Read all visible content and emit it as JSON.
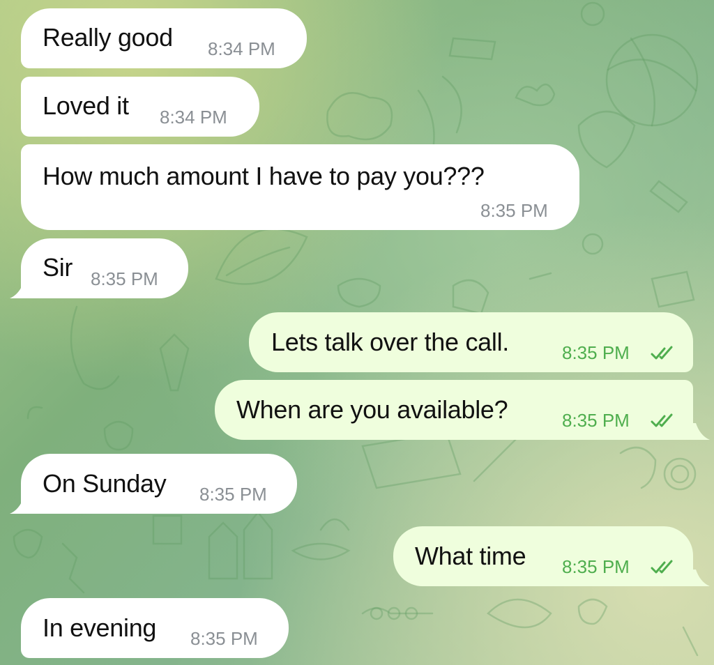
{
  "colors": {
    "incoming_bubble": "#ffffff",
    "outgoing_bubble": "#effedd",
    "incoming_time": "#8a8f94",
    "outgoing_time": "#4fae4e",
    "read_ticks": "#4fae4e"
  },
  "messages": [
    {
      "direction": "incoming",
      "text": "Really good",
      "time": "8:34 PM"
    },
    {
      "direction": "incoming",
      "text": "Loved it",
      "time": "8:34 PM"
    },
    {
      "direction": "incoming",
      "text": "How much amount I have to pay you???",
      "time": "8:35 PM"
    },
    {
      "direction": "incoming",
      "text": "Sir",
      "time": "8:35 PM"
    },
    {
      "direction": "outgoing",
      "text": "Lets talk over the call.",
      "time": "8:35 PM",
      "status_icon": "double-check-icon"
    },
    {
      "direction": "outgoing",
      "text": "When are you available?",
      "time": "8:35 PM",
      "status_icon": "double-check-icon"
    },
    {
      "direction": "incoming",
      "text": "On Sunday",
      "time": "8:35 PM"
    },
    {
      "direction": "outgoing",
      "text": "What time",
      "time": "8:35 PM",
      "status_icon": "double-check-icon"
    },
    {
      "direction": "incoming",
      "text": "In evening",
      "time": "8:35 PM"
    }
  ]
}
